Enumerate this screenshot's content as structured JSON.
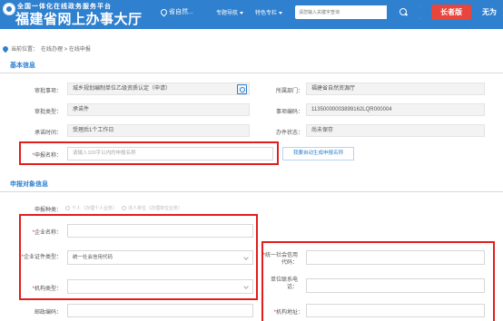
{
  "header": {
    "sub_title": "全国一体化在线政务服务平台",
    "main_title": "福建省网上办事大厅",
    "region": "省自然...",
    "nav": [
      "专题导航",
      "特色专栏"
    ],
    "search_placeholder": "请您输入关键字查询",
    "elder_label": "长者版",
    "barrier_label": "无为"
  },
  "breadcrumb": {
    "current_label": "当前位置：",
    "path": "在线办理 > 在线申报"
  },
  "basic_info": {
    "title": "基本信息",
    "approval_item": {
      "label": "审批事项：",
      "value": "城乡规划编制单位乙级资质认定（申请）"
    },
    "department": {
      "label": "所属部门：",
      "value": "福建省自然资源厅"
    },
    "approval_type": {
      "label": "审批类型：",
      "value": "承诺件"
    },
    "item_code": {
      "label": "事项编码：",
      "value": "11350000003899162LQR000004"
    },
    "promise_time": {
      "label": "承诺时间：",
      "value": "受理后1个工作日"
    },
    "status": {
      "label": "办件状态：",
      "value": "尚未保存"
    },
    "report_name": {
      "label": "申报名称：",
      "required": "*",
      "placeholder": "请输入100字以内的申报名称"
    },
    "gen_button": "我要自动生成申报名称"
  },
  "applicant": {
    "title": "申报对象信息",
    "type": {
      "label": "申报种类：",
      "options": [
        "个人（办理个人业务）",
        "法人单位（办理单位业务）"
      ]
    },
    "company_name": {
      "required": "*",
      "label": "企业名称："
    },
    "cert_type": {
      "required": "*",
      "label": "企业证件类型：",
      "value": "统一社会信用代码"
    },
    "org_type": {
      "required": "*",
      "label": "机构类型："
    },
    "postal": {
      "label": "邮政编码："
    },
    "credit_code": {
      "required": "*",
      "label": "统一社会信用代码："
    },
    "phone": {
      "label": "单位联系电话："
    },
    "address": {
      "required": "*",
      "label": "机构地址："
    }
  },
  "colors": {
    "brand": "#2f80cf",
    "highlight": "#e21d1d",
    "elder": "#e8453c"
  }
}
